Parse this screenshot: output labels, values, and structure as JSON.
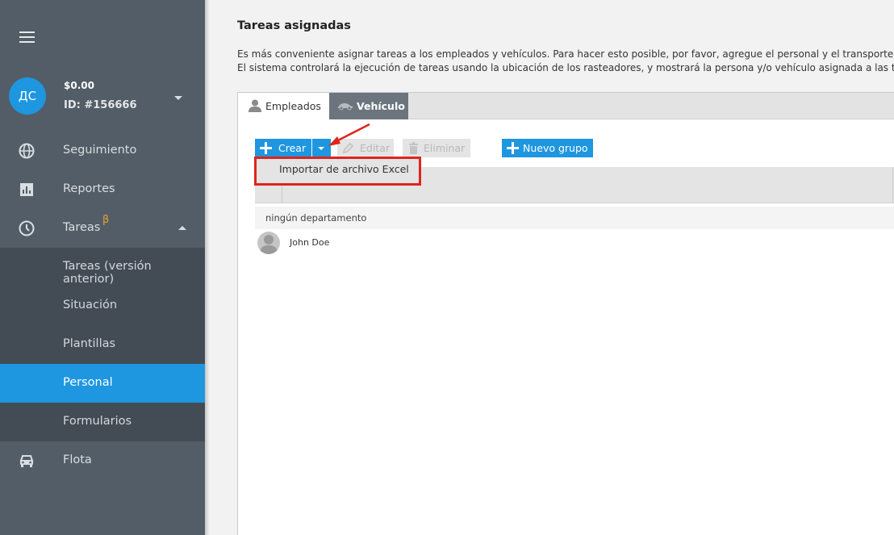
{
  "sidebar": {
    "avatar_initials": "ДС",
    "balance": "$0.00",
    "account_id": "ID: #156666",
    "items": [
      {
        "label": "Seguimiento",
        "icon": "globe-icon"
      },
      {
        "label": "Reportes",
        "icon": "bar-chart-icon"
      },
      {
        "label": "Tareas",
        "icon": "clock-icon",
        "badge": "β"
      },
      {
        "label": "Tareas (versión anterior)"
      },
      {
        "label": "Situación"
      },
      {
        "label": "Plantillas"
      },
      {
        "label": "Personal",
        "active": true
      },
      {
        "label": "Formularios"
      },
      {
        "label": "Flota",
        "icon": "car-icon"
      }
    ]
  },
  "main": {
    "title": "Tareas asignadas",
    "description_line1": "Es más conveniente asignar tareas a los empleados y vehículos. Para hacer esto posible, por favor, agregue el personal y el transporte en",
    "description_line2": "El sistema controlará la ejecución de tareas usando la ubicación de los rasteadores, y mostrará la persona y/o vehículo asignada a las tareas."
  },
  "tabs": [
    {
      "label": "Empleados",
      "icon": "person-icon",
      "active": true
    },
    {
      "label": "Vehículo",
      "icon": "car-icon",
      "active": false
    }
  ],
  "toolbar": {
    "create_label": "Crear",
    "edit_label": "Editar",
    "delete_label": "Eliminar",
    "new_group_label": "Nuevo grupo"
  },
  "dropdown": {
    "import_label": "Importar de archivo Excel"
  },
  "list": {
    "group_label": "ningún departamento",
    "employees": [
      {
        "name": "John Doe"
      }
    ]
  },
  "colors": {
    "accent": "#1e96e0",
    "sidebar_bg": "#525d67",
    "highlight": "#e0241c"
  }
}
